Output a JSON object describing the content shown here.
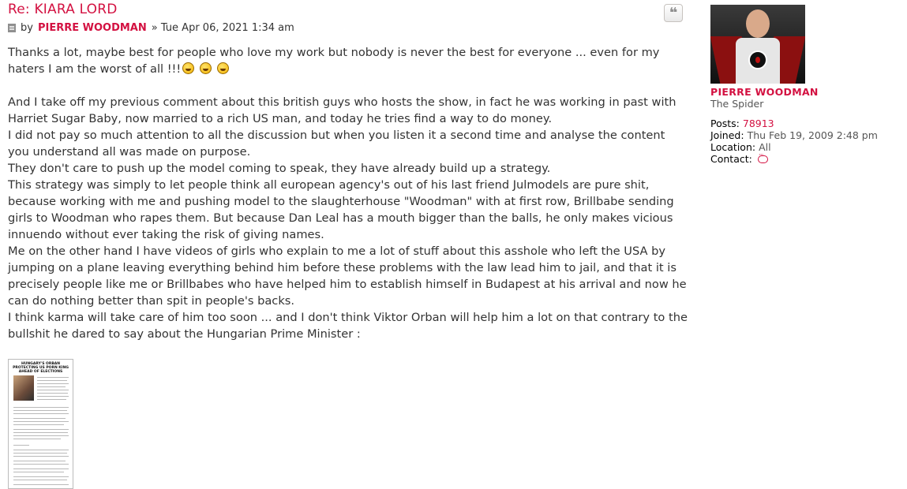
{
  "post": {
    "title": "Re: KIARA LORD",
    "by_label": "by",
    "author": "PIERRE WOODMAN",
    "date": "» Tue Apr 06, 2021 1:34 am",
    "quote_icon": "quote-icon",
    "paragraphs": [
      "Thanks a lot, maybe best for people who love my work but nobody is never the best for everyone ... even for my haters I am the worst of all !!!",
      "",
      "And I take off my previous comment about this british guys who hosts the show, in fact he was working in past with Harriet Sugar Baby, now married to a rich US man, and today he tries find a way to do money.",
      "I did not pay so much attention to all the discussion but when you listen it a second time and analyse the content you understand all was made on purpose.",
      "They don't care to push up the model coming to speak, they have already build up a strategy.",
      "This strategy was simply to let people think all european agency's out of his last friend Julmodels are pure shit, because working with me and pushing model to the slaughterhouse \"Woodman\" with at first row, Brillbabe sending girls to Woodman who rapes them. But because Dan Leal has a mouth bigger than the balls, he only makes vicious innuendo without ever taking the risk of giving names.",
      "Me on the other hand I have videos of girls who explain to me a lot of stuff about this asshole who left the USA by jumping on a plane leaving everything behind him before these problems with the law lead him to jail, and that it is precisely people like me or Brillbabes who have helped him to establish himself in Budapest at his arrival and now he can do nothing better than spit in people's backs.",
      "I think karma will take care of him too soon ... and I don't think Viktor Orban will help him a lot on that contrary to the bullshit he dared to say about the Hungarian Prime Minister :"
    ],
    "smileys": [
      "laughing-smiley-icon",
      "laughing-smiley-icon",
      "laughing-smiley-icon"
    ],
    "attachment": {
      "headline": "HUNGARY'S ORBAN PROTECTING US PORN KING AHEAD OF ELECTIONS"
    }
  },
  "profile": {
    "name": "PIERRE WOODMAN",
    "rank": "The Spider",
    "posts_label": "Posts:",
    "posts_value": "78913",
    "joined_label": "Joined:",
    "joined_value": "Thu Feb 19, 2009 2:48 pm",
    "location_label": "Location:",
    "location_value": "All",
    "contact_label": "Contact:",
    "contact_icon": "speech-bubble-icon"
  }
}
